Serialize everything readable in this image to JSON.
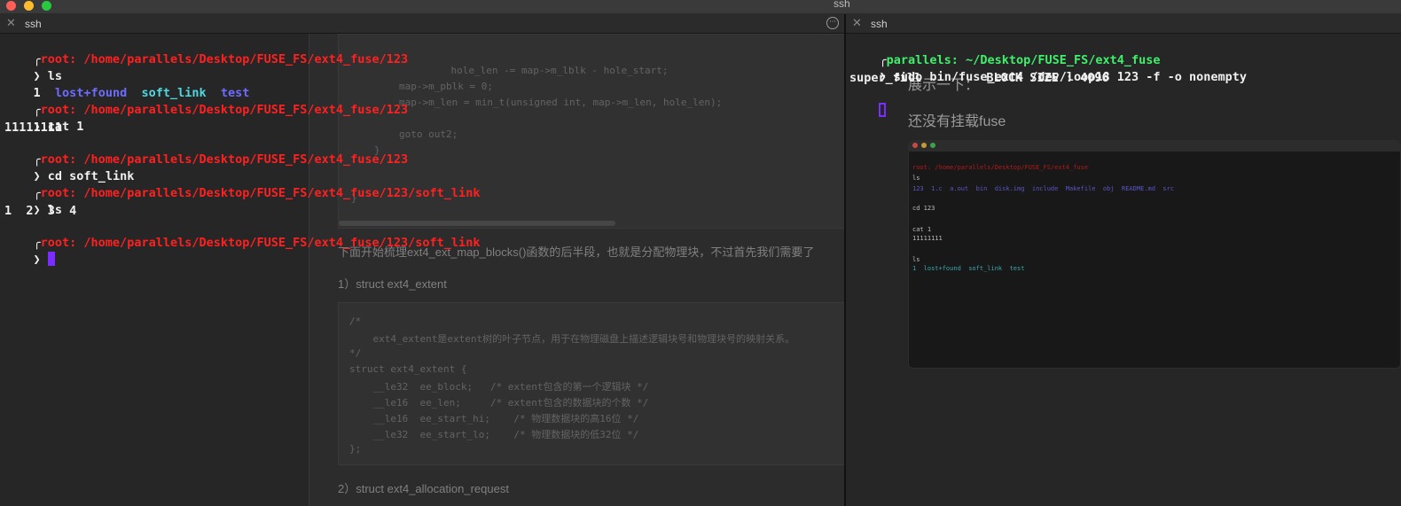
{
  "window": {
    "title": "ssh"
  },
  "tabs": {
    "left": {
      "label": "ssh",
      "close": "✕",
      "more": "···"
    },
    "right": {
      "label": "ssh",
      "close": "✕"
    }
  },
  "left_terminal": {
    "prompt_1": "root: /home/parallels/Desktop/FUSE_FS/ext4_fuse/123",
    "cmd_1": "ls",
    "ls_output": {
      "col1": "1",
      "col2": "lost+found",
      "col3": "soft_link",
      "col4": "test"
    },
    "prompt_2": "root: /home/parallels/Desktop/FUSE_FS/ext4_fuse/123",
    "cmd_2": "cat 1",
    "cat_output": "11111111",
    "prompt_3": "root: /home/parallels/Desktop/FUSE_FS/ext4_fuse/123",
    "cmd_3": "cd soft_link",
    "prompt_4": "root: /home/parallels/Desktop/FUSE_FS/ext4_fuse/123/soft_link",
    "cmd_4": "ls",
    "ls2_output": "1  2  3  4",
    "prompt_5": "root: /home/parallels/Desktop/FUSE_FS/ext4_fuse/123/soft_link",
    "arrow": "❯",
    "corner": "╭"
  },
  "background_article": {
    "code_top": [
      "    hole_len -= map->m_lblk - hole_start;",
      "map->m_pblk = 0;",
      "map->m_len = min_t(unsigned int, map->m_len, hole_len);",
      "",
      "goto out2;",
      "}",
      "",
      "}"
    ],
    "para_1": "下面开始梳理ext4_ext_map_blocks()函数的后半段，也就是分配物理块，不过首先我们需要了",
    "heading_1": "1）struct ext4_extent",
    "code_struct": [
      "/*",
      "    ext4_extent是extent树的叶子节点，用于在物理磁盘上描述逻辑块号和物理块号的映射关系。",
      "*/",
      "struct ext4_extent {",
      "    __le32  ee_block;   /* extent包含的第一个逻辑块 */",
      "    __le16  ee_len;     /* extent包含的数据块的个数 */",
      "    __le16  ee_start_hi;    /* 物理数据块的高16位 */",
      "    __le32  ee_start_lo;    /* 物理数据块的低32位 */",
      "};"
    ],
    "heading_2": "2）struct ext4_allocation_request"
  },
  "right_terminal": {
    "prompt_1": "parallels: ~/Desktop/FUSE_FS/ext4_fuse",
    "cmd_1": "sudo bin/fuse_ext4 /dev/loop18 123 -f -o nonempty",
    "output_1": "super_fill         BLOCK SIZE : 4096",
    "bg_text_1": "展示一下：",
    "bg_text_2": "还没有挂载fuse"
  },
  "thumbnail": {
    "lines": [
      "root: /home/parallels/Desktop/FUSE_FS/ext4_fuse",
      "ls",
      "123  1.c  a.out  bin  disk.img  include  Makefile  obj  README.md  src",
      "cd 123",
      "cat 1",
      "11111111",
      "ls",
      "1  lost+found  soft_link  test"
    ]
  },
  "colors": {
    "prompt_red": "#ff2020",
    "prompt_green": "#3ef06a",
    "dir_blue": "#6e6bff",
    "link_cyan": "#4fd8e0",
    "cursor_purple": "#7b2cff"
  }
}
